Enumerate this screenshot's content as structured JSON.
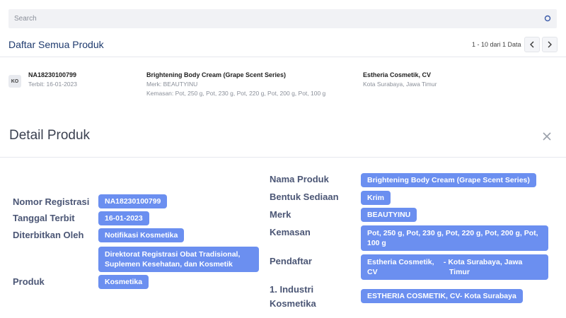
{
  "search": {
    "placeholder": "Search"
  },
  "list": {
    "title": "Daftar Semua Produk",
    "pagination": "1 - 10 dari 1 Data"
  },
  "product_row": {
    "badge": "KO",
    "reg_number": "NA18230100799",
    "issued": "Terbit: 16-01-2023",
    "product_name": "Brightening Body Cream (Grape Scent Series)",
    "brand": "Merk: BEAUTYINU",
    "packaging": "Kemasan: Pot, 250 g, Pot, 230 g, Pot, 220 g, Pot, 200 g, Pot, 100 g",
    "company": "Estheria Cosmetik, CV",
    "location": "Kota Surabaya, Jawa Timur"
  },
  "detail": {
    "title": "Detail Produk",
    "left": {
      "nomor_registrasi_label": "Nomor Registrasi",
      "nomor_registrasi_value": "NA18230100799",
      "tanggal_terbit_label": "Tanggal Terbit",
      "tanggal_terbit_value": "16-01-2023",
      "diterbitkan_oleh_label": "Diterbitkan Oleh",
      "diterbitkan_oleh_value1": "Notifikasi Kosmetika",
      "diterbitkan_oleh_value2_line1": "Direktorat Registrasi Obat Tradisional,",
      "diterbitkan_oleh_value2_line2": "Suplemen Kesehatan, dan Kosmetik",
      "produk_label": "Produk",
      "produk_value": "Kosmetika"
    },
    "right": {
      "nama_produk_label": "Nama Produk",
      "nama_produk_value": "Brightening Body Cream (Grape Scent Series)",
      "bentuk_sediaan_label": "Bentuk Sediaan",
      "bentuk_sediaan_value": "Krim",
      "merk_label": "Merk",
      "merk_value": "BEAUTYINU",
      "kemasan_label": "Kemasan",
      "kemasan_value_line1": "Pot, 250 g, Pot, 230 g, Pot, 220 g, Pot, 200 g, Pot,",
      "kemasan_value_line2": "100 g",
      "pendaftar_label": "Pendaftar",
      "pendaftar_company_line1": "Estheria Cosmetik,",
      "pendaftar_company_line2": "CV",
      "pendaftar_location_line1": "- Kota Surabaya, Jawa",
      "pendaftar_location_line2": "Timur",
      "industri_label_line1": "1. Industri",
      "industri_label_line2": "Kosmetika",
      "industri_value": "ESTHERIA COSMETIK, CV- Kota Surabaya"
    }
  },
  "colors": {
    "pill": "#6b8ff0",
    "title": "#1e3a6e",
    "label": "#4b5675"
  },
  "icons": [
    "search-icon",
    "chevron-left-icon",
    "chevron-right-icon",
    "close-icon"
  ]
}
